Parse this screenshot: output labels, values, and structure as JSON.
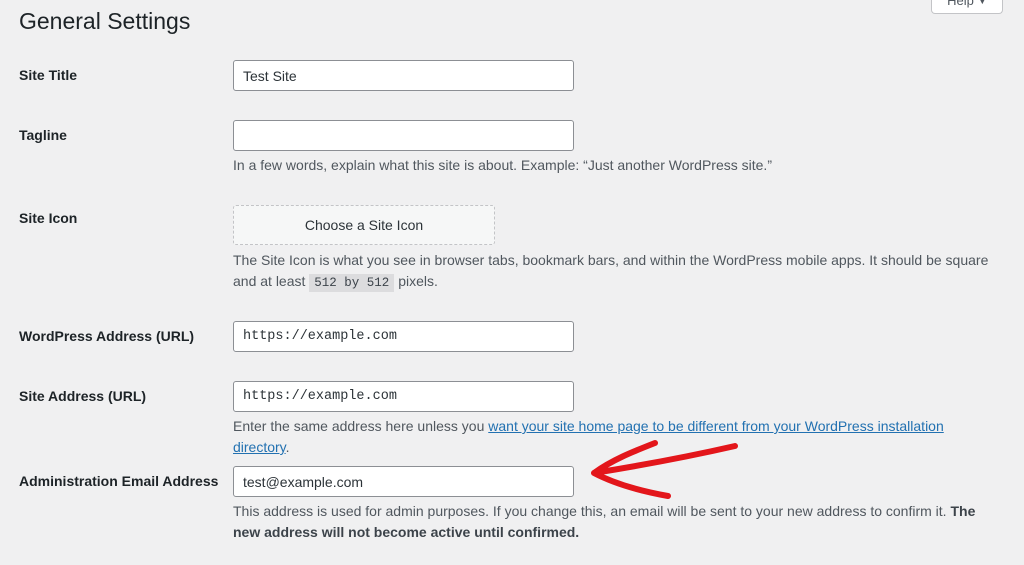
{
  "page": {
    "title": "General Settings",
    "help_label": "Help"
  },
  "fields": {
    "site_title": {
      "label": "Site Title",
      "value": "Test Site"
    },
    "tagline": {
      "label": "Tagline",
      "value": "",
      "description": "In a few words, explain what this site is about. Example: “Just another WordPress site.”"
    },
    "site_icon": {
      "label": "Site Icon",
      "button_label": "Choose a Site Icon",
      "description_part1": "The Site Icon is what you see in browser tabs, bookmark bars, and within the WordPress mobile apps. It should be square and at least",
      "description_code": "512 by 512",
      "description_part2": "pixels."
    },
    "wordpress_address": {
      "label": "WordPress Address (URL)",
      "value": "https://example.com"
    },
    "site_address": {
      "label": "Site Address (URL)",
      "value": "https://example.com",
      "description_prefix": "Enter the same address here unless you",
      "description_link": "want your site home page to be different from your WordPress installation directory",
      "description_suffix": "."
    },
    "admin_email": {
      "label": "Administration Email Address",
      "value": "test@example.com",
      "description_text": "This address is used for admin purposes. If you change this, an email will be sent to your new address to confirm it.",
      "description_bold": "The new address will not become active until confirmed."
    }
  },
  "annotation": {
    "arrow_color": "#e3161b",
    "arrow_icon": "hand-drawn-arrow-left-icon"
  },
  "colors": {
    "background": "#f0f0f1",
    "link": "#2271b1",
    "text": "#1d2327",
    "muted_text": "#50575e"
  }
}
